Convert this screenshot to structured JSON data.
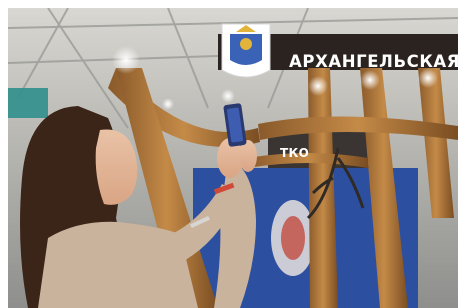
{
  "scene": {
    "sign": {
      "text": "АРХАНГЕЛЬСКАЯ",
      "partial_text": "ТКО"
    },
    "colors": {
      "ceiling": "#c9c7c0",
      "wood": "#b07a3c",
      "wood_dark": "#7c4f22",
      "hair": "#3b2418",
      "sweater": "#c9b39d",
      "sign_bg": "#2b2320",
      "blue_panel": "#2d4fa0"
    }
  }
}
